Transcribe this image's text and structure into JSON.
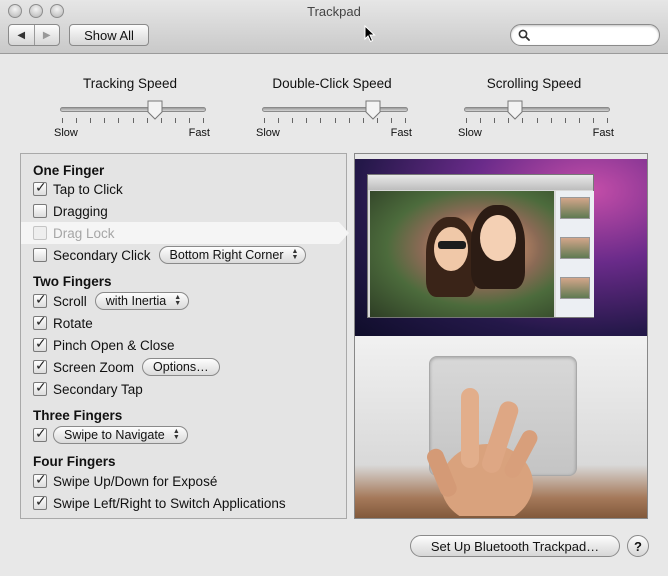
{
  "window": {
    "title": "Trackpad"
  },
  "toolbar": {
    "back_glyph": "◀",
    "forward_glyph": "▶",
    "show_all": "Show All",
    "search_placeholder": "",
    "search_value": ""
  },
  "sliders": [
    {
      "title": "Tracking Speed",
      "min_label": "Slow",
      "max_label": "Fast",
      "value": 0.65
    },
    {
      "title": "Double-Click Speed",
      "min_label": "Slow",
      "max_label": "Fast",
      "value": 0.76
    },
    {
      "title": "Scrolling Speed",
      "min_label": "Slow",
      "max_label": "Fast",
      "value": 0.35
    }
  ],
  "one_finger": {
    "header": "One Finger",
    "tap_to_click": {
      "label": "Tap to Click",
      "checked": true
    },
    "dragging": {
      "label": "Dragging",
      "checked": false
    },
    "drag_lock": {
      "label": "Drag Lock",
      "checked": false,
      "enabled": false
    },
    "secondary_click": {
      "label": "Secondary Click",
      "checked": false,
      "option": "Bottom Right Corner"
    }
  },
  "two_fingers": {
    "header": "Two Fingers",
    "scroll": {
      "label": "Scroll",
      "checked": true,
      "option": "with Inertia"
    },
    "rotate": {
      "label": "Rotate",
      "checked": true
    },
    "pinch": {
      "label": "Pinch Open & Close",
      "checked": true
    },
    "screen_zoom": {
      "label": "Screen Zoom",
      "checked": true,
      "button": "Options…"
    },
    "secondary_tap": {
      "label": "Secondary Tap",
      "checked": true
    }
  },
  "three_fingers": {
    "header": "Three Fingers",
    "swipe": {
      "checked": true,
      "option": "Swipe to Navigate"
    }
  },
  "four_fingers": {
    "header": "Four Fingers",
    "expose": {
      "label": "Swipe Up/Down for Exposé",
      "checked": true
    },
    "switch_apps": {
      "label": "Swipe Left/Right to Switch Applications",
      "checked": true
    }
  },
  "footer": {
    "bluetooth_button": "Set Up Bluetooth Trackpad…",
    "help": "?"
  },
  "icons": [
    "search-icon",
    "pointer-cursor-icon",
    "back-arrow-icon",
    "forward-arrow-icon",
    "help-icon"
  ]
}
